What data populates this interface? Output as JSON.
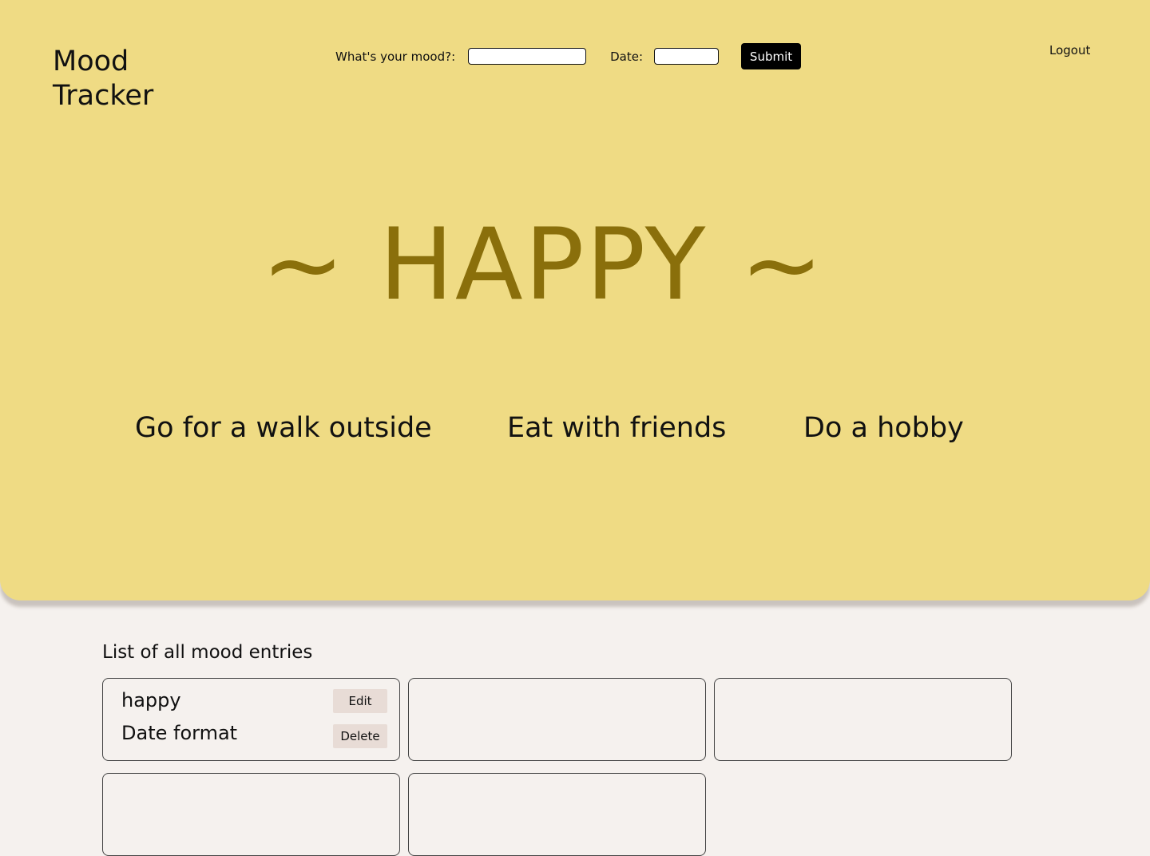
{
  "header": {
    "app_title": "Mood Tracker",
    "logout_label": "Logout"
  },
  "form": {
    "mood_label": "What's your mood?:",
    "mood_value": "",
    "date_label": "Date:",
    "date_value": "",
    "submit_label": "Submit"
  },
  "current_mood": {
    "display": "~ HAPPY ~"
  },
  "suggestions": [
    "Go for a walk outside",
    "Eat with friends",
    "Do a hobby"
  ],
  "entries_section": {
    "title": "List of all mood entries",
    "entries": [
      {
        "mood": "happy",
        "date": "Date format",
        "edit_label": "Edit",
        "delete_label": "Delete"
      }
    ]
  },
  "colors": {
    "hero_background": "#efdb84",
    "page_background": "#f5f1ee",
    "mood_text": "#8a6f0b",
    "button_dark": "#000000",
    "card_button": "#e8dcd6"
  }
}
